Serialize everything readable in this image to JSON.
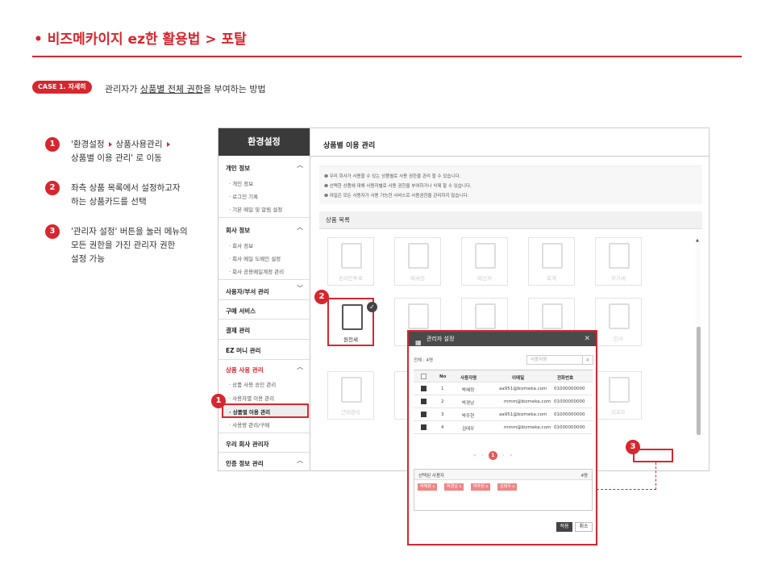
{
  "header": {
    "title": "• 비즈메카이지 ez한 활용법 > 포탈"
  },
  "case": {
    "badge": "CASE 1. 자세히",
    "desc_pre": "관리자가 ",
    "desc_ul": "상품별 전체 권한",
    "desc_post": "을 부여하는 방법"
  },
  "steps": [
    {
      "num": "1",
      "line1_a": "'환경설정",
      "line1_b": "상품사용관리",
      "line2": "상품별 이용 관리' 로 이동"
    },
    {
      "num": "2",
      "line1": "좌측 상품  목록에서 설정하고자",
      "line2": "하는 상품카드를 선택"
    },
    {
      "num": "3",
      "line1": "'관리자 설정' 버튼을 눌러 메뉴의",
      "line2": "모든 권한을 가진 관리자 권한",
      "line3": "설정 가능"
    }
  ],
  "sidebar": {
    "title": "환경설정",
    "personal": {
      "label": "개인 정보",
      "items": [
        "개인 정보",
        "로그인 기록",
        "기본 메일 및 알림 설정"
      ]
    },
    "company": {
      "label": "회사 정보",
      "items": [
        "회사 정보",
        "회사 메일 도메인 설정",
        "회사 공용메일계정 관리"
      ]
    },
    "users": "사용자/부서 관리",
    "purchase": "구매 서비스",
    "payment": "결제 관리",
    "ezmoney": "EZ 머니 관리",
    "product": {
      "label": "상품 사용 관리",
      "items": [
        "상품 사용 승인 관리",
        "사용자별 이용 관리",
        "상품별 이용 관리",
        "사용량 관리/구매"
      ]
    },
    "our_admin": "우리 회사 관리자",
    "cert": "인증 정보 관리"
  },
  "main": {
    "title": "상품별 이용 관리",
    "notices": [
      "우리 회사가 사용할 수 있는 상품별로 사용 권한을 관리 할 수 있습니다.",
      "선택한 상품에 대해 사용자별로 사용 권한을 부여하거나 삭제 할 수 있습니다.",
      "여일은 모든 사용자가 사용 가능한 서비스로 사용권한을 관리하지 않습니다."
    ],
    "list_title": "상품 목록",
    "cards_row1": [
      "온라인투표",
      "메세징",
      "메신저",
      "회계",
      "부가세"
    ],
    "card_selected": "원천세",
    "cards_row2_right": "인사",
    "card_row3_left": "근태관리",
    "card_row3_right": "리포트"
  },
  "callouts": {
    "one": "1",
    "two": "2",
    "three": "3"
  },
  "modal": {
    "title": "관리자 설정",
    "close": "✕",
    "total": "전체 : 4명",
    "search_placeholder": "사용자명",
    "headers": {
      "no": "No",
      "name": "사용자명",
      "mail": "이메일",
      "tel": "전화번호"
    },
    "rows": [
      {
        "no": "1",
        "name": "박혜정",
        "mail": "aa951@bizmeka.com",
        "tel": "01000000000"
      },
      {
        "no": "2",
        "name": "박경남",
        "mail": "mmm@bizmeka.com",
        "tel": "01000000000"
      },
      {
        "no": "3",
        "name": "박주현",
        "mail": "aa951@bizmeka.com",
        "tel": "01000000000"
      },
      {
        "no": "4",
        "name": "김태우",
        "mail": "mmm@bizmeka.com",
        "tel": "01000000000"
      }
    ],
    "pager": {
      "first": "«",
      "prev": "‹",
      "page": "1",
      "next": "›",
      "last": "»"
    },
    "selected_label": "선택된 사용자",
    "selected_count": "4명",
    "tags": [
      "박혜정 x",
      "박경남 x",
      "박주현 x",
      "김태우 x"
    ],
    "apply": "적용",
    "cancel": "취소"
  },
  "colors": {
    "accent": "#d7262e",
    "dark": "#3a3a3a"
  }
}
